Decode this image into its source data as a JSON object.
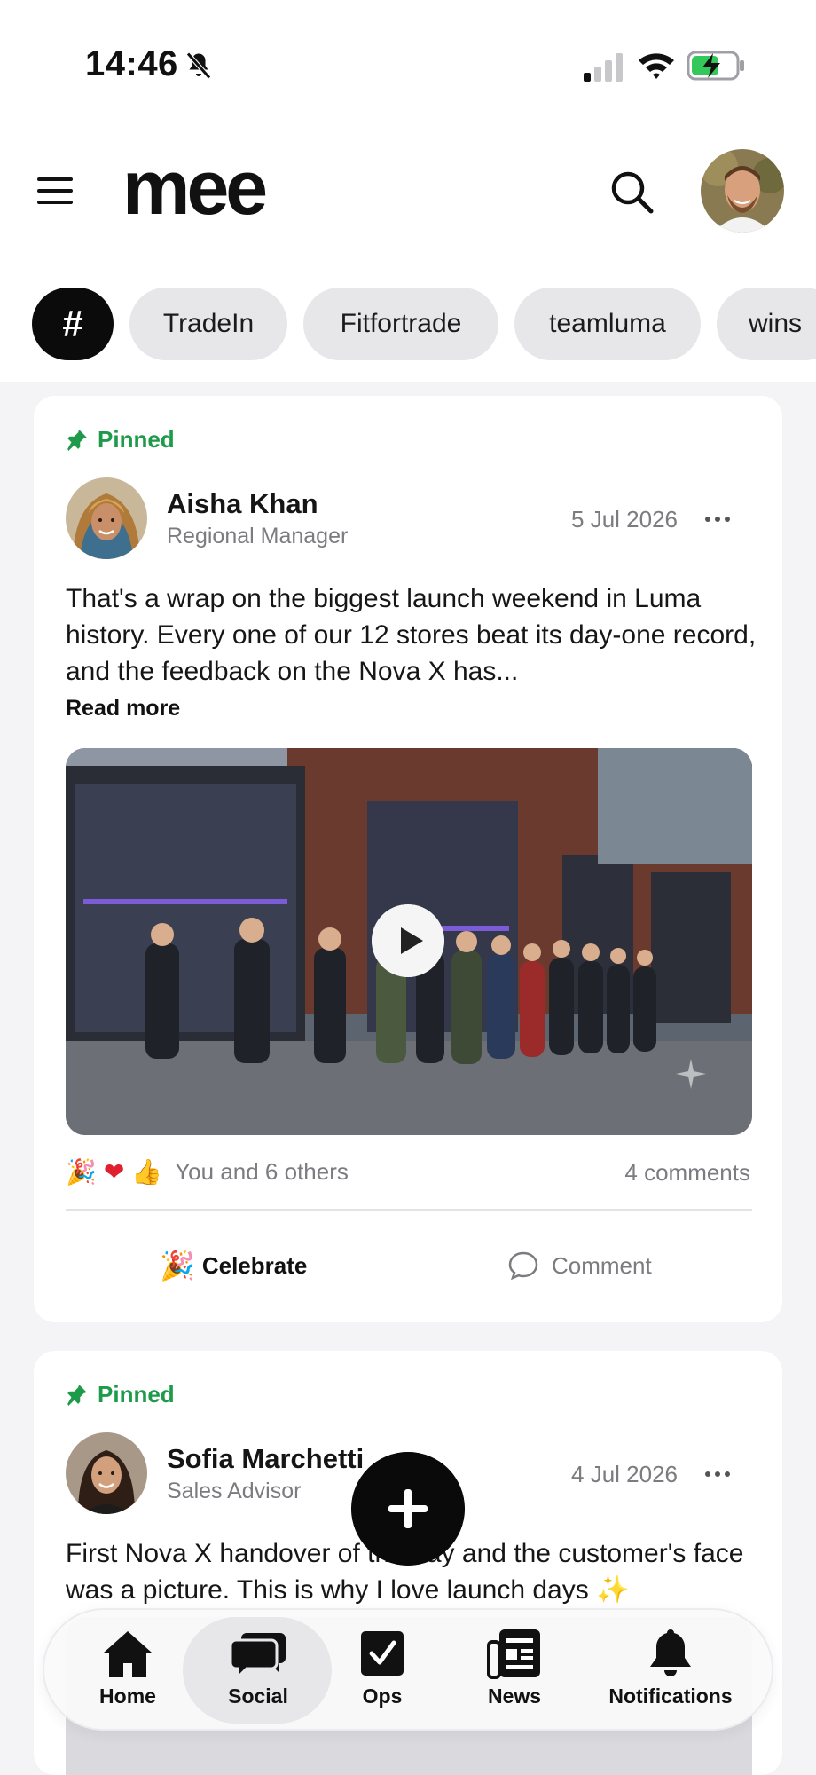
{
  "status_bar": {
    "time": "14:46"
  },
  "header": {
    "logo": "mee"
  },
  "hashtags": [
    {
      "label": "#"
    },
    {
      "label": "TradeIn"
    },
    {
      "label": "Fitfortrade"
    },
    {
      "label": "teamluma"
    },
    {
      "label": "wins"
    }
  ],
  "posts": [
    {
      "pinned_label": "Pinned",
      "author": "Aisha Khan",
      "role": "Regional Manager",
      "date": "5 Jul 2026",
      "text": "That's a wrap on the biggest launch weekend in Luma history. Every one of our 12 stores beat its day-one record, and the feedback on the Nova X has...",
      "read_more": "Read more",
      "reactions_text": "You and 6 others",
      "comments": "4 comments",
      "actions": {
        "celebrate": "Celebrate",
        "comment": "Comment"
      }
    },
    {
      "pinned_label": "Pinned",
      "author": "Sofia Marchetti",
      "role": "Sales Advisor",
      "date": "4 Jul 2026",
      "text": "First Nova X handover of the day and the customer's face was a picture. This is why I love launch days ✨"
    }
  ],
  "nav": {
    "items": [
      {
        "label": "Home"
      },
      {
        "label": "Social"
      },
      {
        "label": "Ops"
      },
      {
        "label": "News"
      },
      {
        "label": "Notifications"
      }
    ],
    "active": "Social"
  },
  "colors": {
    "accent_green": "#1d9a4a",
    "fab": "#0a0a0a",
    "chip_bg": "#e7e7ea"
  }
}
